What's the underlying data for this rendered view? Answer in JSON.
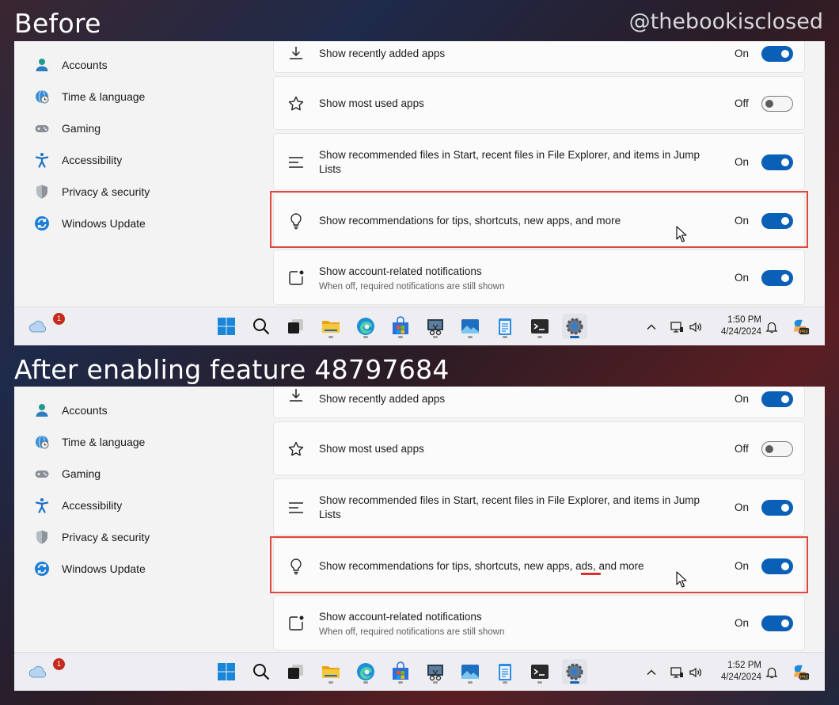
{
  "captions": {
    "before": "Before",
    "after": "After enabling feature 48797684",
    "watermark": "@thebookisclosed"
  },
  "sidebar": {
    "items": [
      {
        "label": "Accounts",
        "icon": "person-icon"
      },
      {
        "label": "Time & language",
        "icon": "globe-clock-icon"
      },
      {
        "label": "Gaming",
        "icon": "gamepad-icon"
      },
      {
        "label": "Accessibility",
        "icon": "accessibility-icon"
      },
      {
        "label": "Privacy & security",
        "icon": "shield-icon"
      },
      {
        "label": "Windows Update",
        "icon": "update-icon"
      }
    ]
  },
  "before": {
    "settings": [
      {
        "label": "Show recently added apps",
        "state": "On",
        "icon": "download-icon"
      },
      {
        "label": "Show most used apps",
        "state": "Off",
        "icon": "star-icon"
      },
      {
        "label": "Show recommended files in Start, recent files in File Explorer, and items in Jump Lists",
        "state": "On",
        "icon": "list-icon"
      },
      {
        "label": "Show recommendations for tips, shortcuts, new apps, and more",
        "state": "On",
        "icon": "lightbulb-icon"
      },
      {
        "label": "Show account-related notifications",
        "sublabel": "When off, required notifications are still shown",
        "state": "On",
        "icon": "notification-icon"
      }
    ],
    "clock": {
      "time": "1:50 PM",
      "date": "4/24/2024"
    }
  },
  "after": {
    "settings": [
      {
        "label": "Show recently added apps",
        "state": "On",
        "icon": "download-icon"
      },
      {
        "label": "Show most used apps",
        "state": "Off",
        "icon": "star-icon"
      },
      {
        "label": "Show recommended files in Start, recent files in File Explorer, and items in Jump Lists",
        "state": "On",
        "icon": "list-icon"
      },
      {
        "label_before": "Show recommendations for tips, shortcuts, new apps, ",
        "label_ads": "ads",
        "label_after": ", and more",
        "state": "On",
        "icon": "lightbulb-icon"
      },
      {
        "label": "Show account-related notifications",
        "sublabel": "When off, required notifications are still shown",
        "state": "On",
        "icon": "notification-icon"
      }
    ],
    "clock": {
      "time": "1:52 PM",
      "date": "4/24/2024"
    }
  },
  "taskbar": {
    "widget_badge": "1",
    "apps": [
      "start-icon",
      "search-icon",
      "task-view-icon",
      "file-explorer-icon",
      "edge-icon",
      "store-icon",
      "snipping-tool-icon",
      "photos-icon",
      "notepad-icon",
      "terminal-icon",
      "settings-icon"
    ],
    "tray": [
      "chevron-up-icon",
      "network-icon",
      "volume-icon",
      "bell-icon",
      "copilot-icon"
    ]
  },
  "colors": {
    "accent": "#0a5fb6",
    "highlight": "#e0473a",
    "underline": "#d9302a"
  }
}
